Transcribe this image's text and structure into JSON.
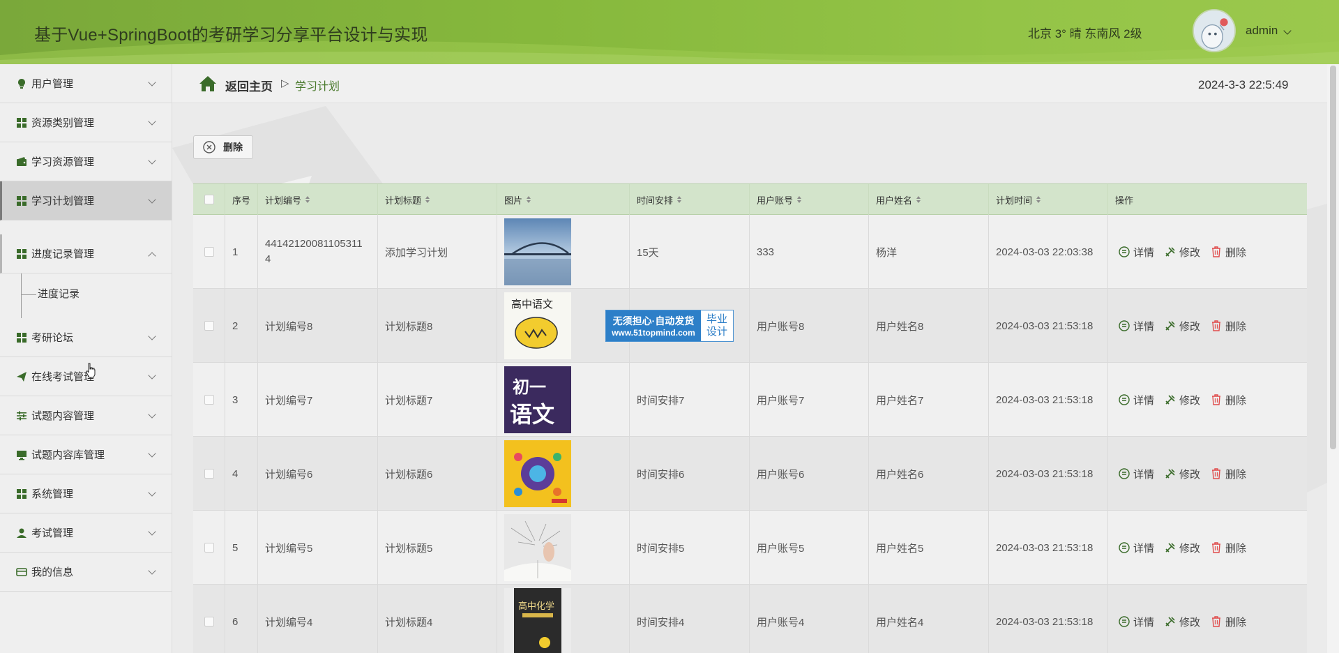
{
  "header": {
    "title": "基于Vue+SpringBoot的考研学习分享平台设计与实现",
    "weather": "北京  3°  晴  东南风  2级",
    "user": "admin"
  },
  "sidebar": {
    "items": [
      {
        "label": "用户管理",
        "icon": "lightbulb-icon"
      },
      {
        "label": "资源类别管理",
        "icon": "grid-icon"
      },
      {
        "label": "学习资源管理",
        "icon": "wallet-icon"
      },
      {
        "label": "学习计划管理",
        "icon": "grid-icon"
      },
      {
        "label": "进度记录管理",
        "icon": "grid-icon"
      },
      {
        "label": "考研论坛",
        "icon": "grid-icon"
      },
      {
        "label": "在线考试管理",
        "icon": "send-icon"
      },
      {
        "label": "试题内容管理",
        "icon": "sliders-icon"
      },
      {
        "label": "试题内容库管理",
        "icon": "monitor-icon"
      },
      {
        "label": "系统管理",
        "icon": "grid-icon"
      },
      {
        "label": "考试管理",
        "icon": "user-icon"
      },
      {
        "label": "我的信息",
        "icon": "card-icon"
      }
    ],
    "sub_item": "进度记录"
  },
  "breadcrumb": {
    "back": "返回主页",
    "sep": "▷",
    "current": "学习计划"
  },
  "datetime": "2024-3-3 22:5:49",
  "toolbar": {
    "delete_label": "删除"
  },
  "table": {
    "headers": [
      "序号",
      "计划编号",
      "计划标题",
      "图片",
      "时间安排",
      "用户账号",
      "用户姓名",
      "计划时间",
      "操作"
    ],
    "ops": {
      "detail": "详情",
      "edit": "修改",
      "delete": "删除"
    },
    "rows": [
      {
        "no": "1",
        "code": "44142120081105311\n4",
        "title": "添加学习计划",
        "schedule": "15天",
        "account": "333",
        "name": "杨洋",
        "time": "2024-03-03 22:03:38",
        "img": "bridge"
      },
      {
        "no": "2",
        "code": "计划编号8",
        "title": "计划标题8",
        "schedule": "",
        "account": "用户账号8",
        "name": "用户姓名8",
        "time": "2024-03-03 21:53:18",
        "img": "chinese-high",
        "img_text": "高中语文"
      },
      {
        "no": "3",
        "code": "计划编号7",
        "title": "计划标题7",
        "schedule": "时间安排7",
        "account": "用户账号7",
        "name": "用户姓名7",
        "time": "2024-03-03 21:53:18",
        "img": "chinese-junior",
        "img_text1": "初一",
        "img_text2": "语文"
      },
      {
        "no": "4",
        "code": "计划编号6",
        "title": "计划标题6",
        "schedule": "时间安排6",
        "account": "用户账号6",
        "name": "用户姓名6",
        "time": "2024-03-03 21:53:18",
        "img": "mindmap"
      },
      {
        "no": "5",
        "code": "计划编号5",
        "title": "计划标题5",
        "schedule": "时间安排5",
        "account": "用户账号5",
        "name": "用户姓名5",
        "time": "2024-03-03 21:53:18",
        "img": "book"
      },
      {
        "no": "6",
        "code": "计划编号4",
        "title": "计划标题4",
        "schedule": "时间安排4",
        "account": "用户账号4",
        "name": "用户姓名4",
        "time": "2024-03-03 21:53:18",
        "img": "chemistry",
        "img_text": "高中化学"
      }
    ]
  },
  "watermark": {
    "line1": "无须担心·自动发货",
    "line2": "www.51topmind.com",
    "right1": "毕业",
    "right2": "设计"
  },
  "colors": {
    "header": "#86b83c",
    "table_header": "#d3e4cb",
    "accent": "#4a7a2d"
  }
}
